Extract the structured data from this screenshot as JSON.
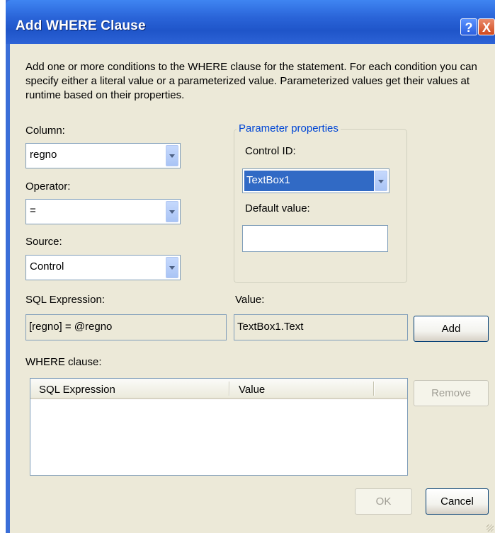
{
  "window": {
    "title": "Add WHERE Clause",
    "help_glyph": "?",
    "close_glyph": "X"
  },
  "description": "Add one or more conditions to the WHERE clause for the statement. For each condition you can specify either a literal value or a parameterized value. Parameterized values get their values at runtime based on their properties.",
  "column": {
    "label": "Column:",
    "value": "regno"
  },
  "operator": {
    "label": "Operator:",
    "value": "="
  },
  "source": {
    "label": "Source:",
    "value": "Control"
  },
  "parameter_properties": {
    "legend": "Parameter properties",
    "control_id_label": "Control ID:",
    "control_id_value": "TextBox1",
    "default_value_label": "Default value:",
    "default_value": ""
  },
  "sql_expression": {
    "label": "SQL Expression:",
    "value": "[regno] = @regno"
  },
  "value": {
    "label": "Value:",
    "value": "TextBox1.Text"
  },
  "buttons": {
    "add": "Add",
    "remove": "Remove",
    "ok": "OK",
    "cancel": "Cancel"
  },
  "where_clause": {
    "label": "WHERE clause:",
    "columns": [
      "SQL Expression",
      "Value"
    ],
    "rows": []
  },
  "colors": {
    "titlebar": "#2a64d8",
    "dialog_bg": "#ece9d8",
    "selection": "#316ac5",
    "legend_text": "#0046d5"
  }
}
